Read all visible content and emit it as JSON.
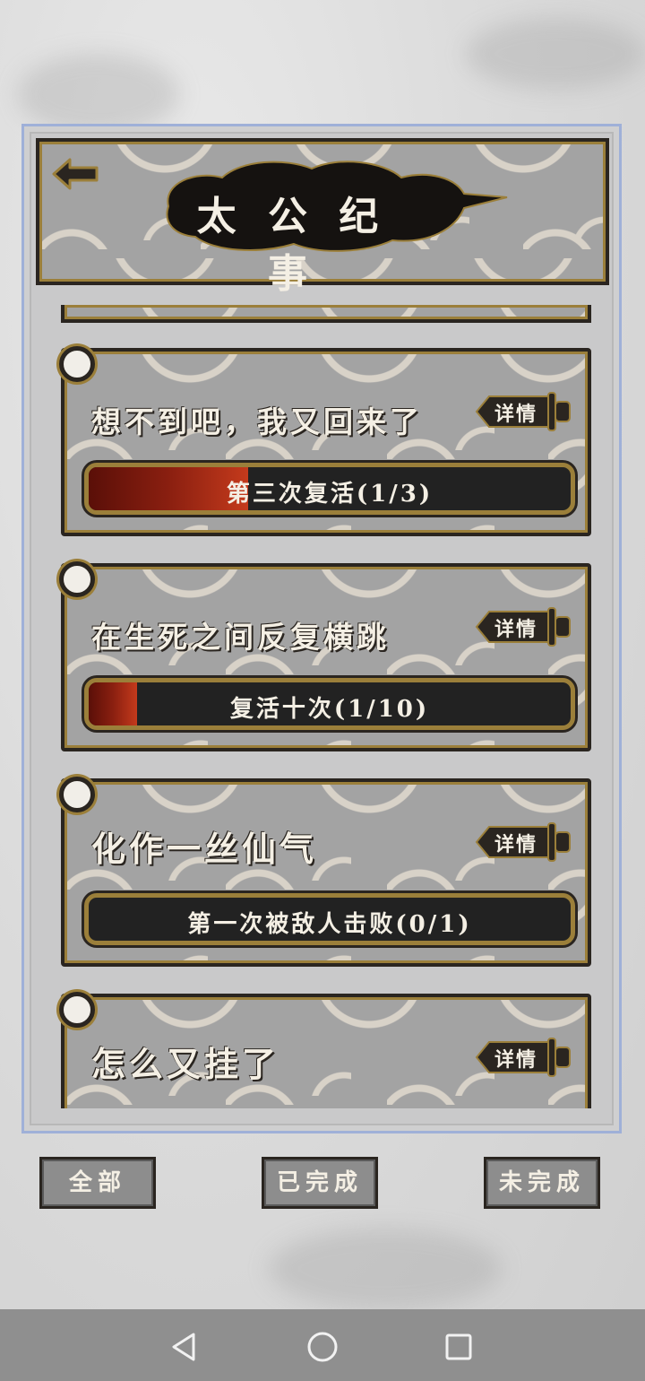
{
  "header": {
    "title": "太 公 纪 事"
  },
  "achievements": [
    {
      "title": "想不到吧，我又回来了",
      "detail_label": "详情",
      "progress_text": "第三次复活(1/3)",
      "progress": 0.33
    },
    {
      "title": "在生死之间反复横跳",
      "detail_label": "详情",
      "progress_text": "复活十次(1/10)",
      "progress": 0.1
    },
    {
      "title": "化作一丝仙气",
      "detail_label": "详情",
      "progress_text": "第一次被敌人击败(0/1)",
      "progress": 0
    },
    {
      "title": "怎么又挂了",
      "detail_label": "详情"
    }
  ],
  "filters": {
    "all": "全部",
    "completed": "已完成",
    "incomplete": "未完成"
  },
  "colors": {
    "frame_border": "#9fb0d8",
    "gold_border": "#9b7f3a",
    "progress_red": "#c43a1c",
    "ink": "#2a2520"
  },
  "icons": {
    "back": "arrow-left-icon",
    "detail": "sword-icon",
    "nav": [
      "back-triangle-icon",
      "home-circle-icon",
      "recents-square-icon"
    ]
  }
}
